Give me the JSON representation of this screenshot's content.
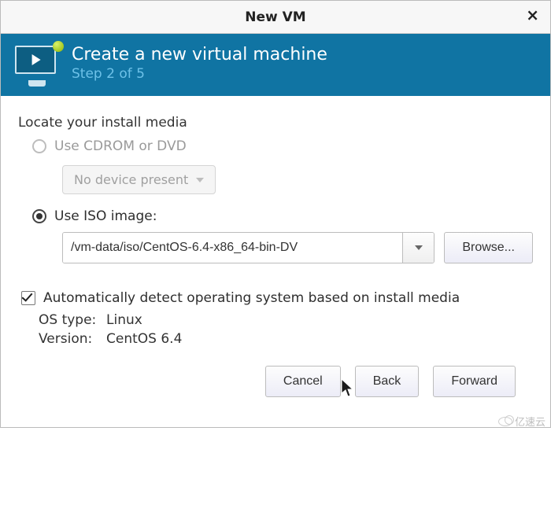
{
  "window": {
    "title": "New VM",
    "close_glyph": "×"
  },
  "banner": {
    "heading": "Create a new virtual machine",
    "step_label": "Step 2 of 5"
  },
  "media": {
    "section_label": "Locate your install media",
    "option_cdrom": {
      "label": "Use CDROM or DVD",
      "selected": false,
      "device_combobox_text": "No device present"
    },
    "option_iso": {
      "label": "Use ISO image:",
      "selected": true,
      "path_value": "/vm-data/iso/CentOS-6.4-x86_64-bin-DV",
      "browse_label": "Browse..."
    }
  },
  "autodetect": {
    "checkbox_label": "Automatically detect operating system based on install media",
    "checked": true,
    "os_type_label": "OS type:",
    "os_type_value": "Linux",
    "version_label": "Version:",
    "version_value": "CentOS 6.4"
  },
  "footer": {
    "cancel": "Cancel",
    "back": "Back",
    "forward": "Forward"
  },
  "watermark": "亿速云"
}
